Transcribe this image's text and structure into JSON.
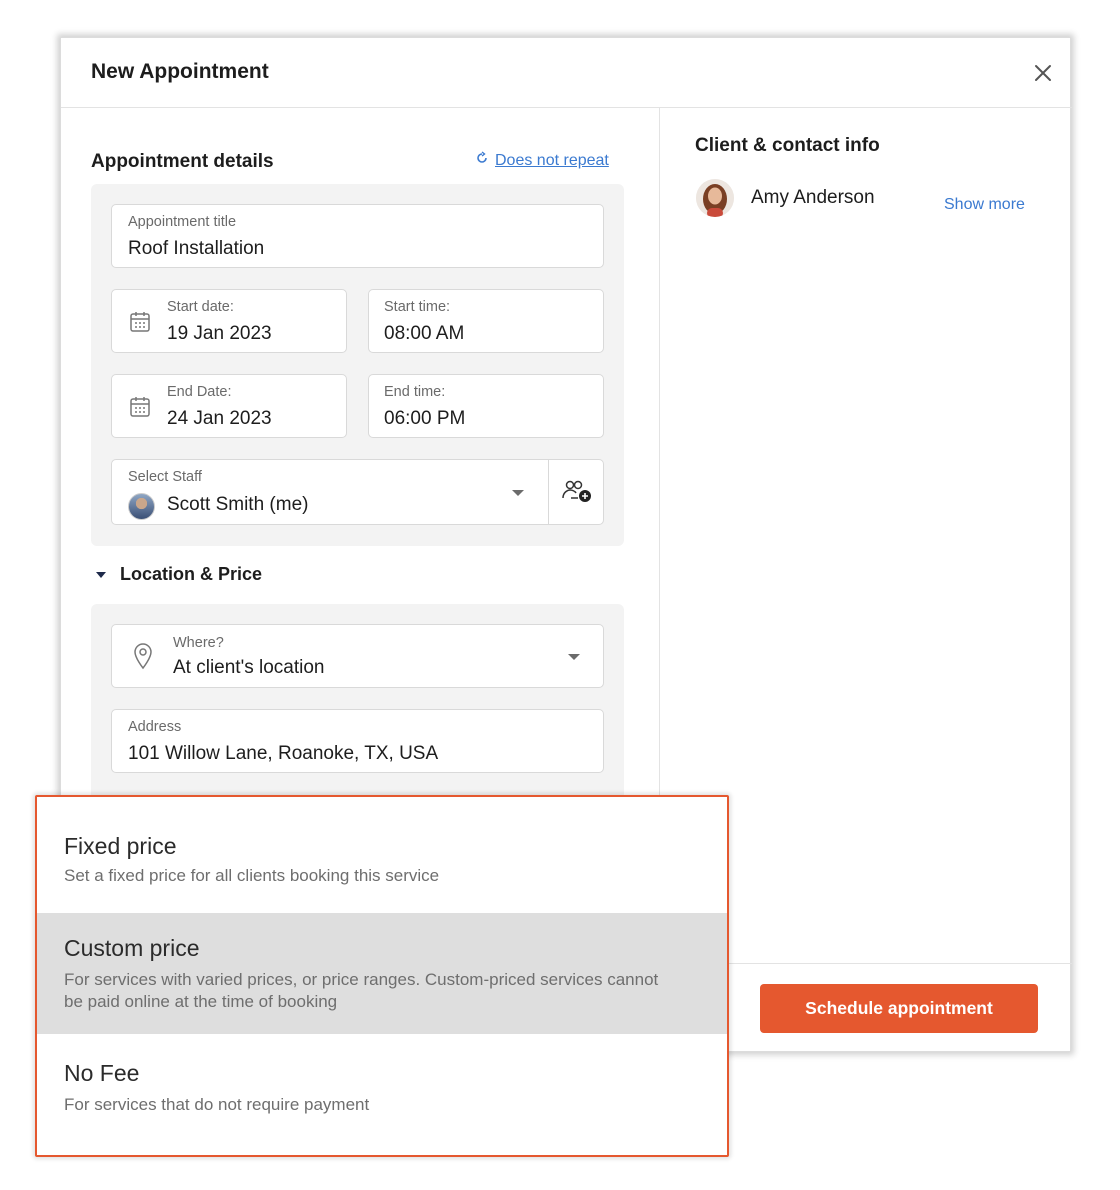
{
  "modal": {
    "title": "New Appointment",
    "close_icon": "close-icon"
  },
  "details": {
    "section_title": "Appointment details",
    "repeat_link": "Does not repeat",
    "repeat_icon": "repeat-icon"
  },
  "fields": {
    "title_label": "Appointment title",
    "title_value": "Roof Installation",
    "start_date_label": "Start date:",
    "start_date_value": "19 Jan 2023",
    "start_time_label": "Start time:",
    "start_time_value": "08:00 AM",
    "end_date_label": "End Date:",
    "end_date_value": "24 Jan 2023",
    "end_time_label": "End time:",
    "end_time_value": "06:00 PM",
    "staff_label": "Select Staff",
    "staff_value": "Scott Smith (me)"
  },
  "location": {
    "section_title": "Location & Price",
    "where_label": "Where?",
    "where_value": "At client's location",
    "address_label": "Address",
    "address_value": "101 Willow Lane, Roanoke, TX, USA"
  },
  "client": {
    "section_title": "Client & contact info",
    "name": "Amy Anderson",
    "show_more": "Show more"
  },
  "footer": {
    "schedule_button": "Schedule appointment"
  },
  "price_options": [
    {
      "title": "Fixed price",
      "description": "Set a fixed price for all clients booking this service",
      "highlighted": false
    },
    {
      "title": "Custom price",
      "description": "For services with varied prices, or price ranges. Custom-priced services cannot be paid online at the time of booking",
      "highlighted": true
    },
    {
      "title": "No Fee",
      "description": "For services that do not require payment",
      "highlighted": false
    }
  ],
  "colors": {
    "accent": "#e5582f",
    "link": "#3b7ad0",
    "highlight": "#dedede",
    "panel": "#f3f3f3"
  }
}
